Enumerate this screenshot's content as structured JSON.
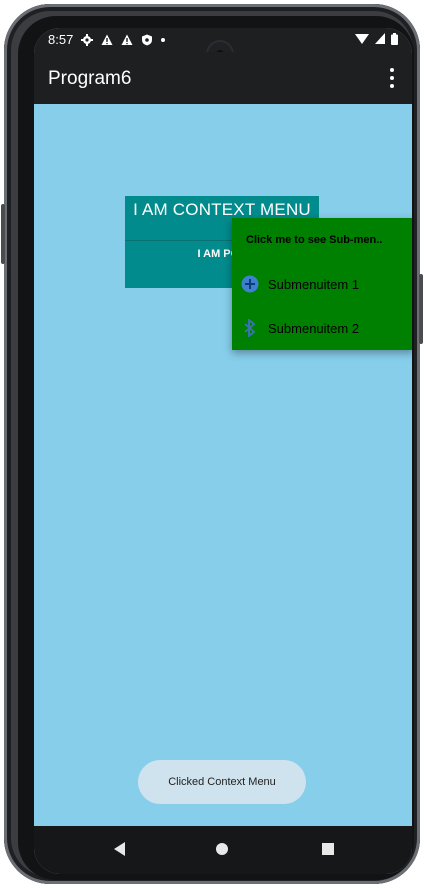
{
  "status_bar": {
    "time": "8:57",
    "left_icons": [
      "settings-gear-icon",
      "warning-icon",
      "warning-icon",
      "shield-icon",
      "dot-icon"
    ],
    "right_icons": [
      "wifi-icon",
      "signal-icon",
      "battery-icon"
    ]
  },
  "app_bar": {
    "title": "Program6",
    "overflow_icon": "more-vert-icon"
  },
  "main": {
    "context_menu_button_label": "I AM CONTEXT MENU",
    "popup_button_label": "I AM POP",
    "background_color": "#87ceeb",
    "button_color": "#028b8d"
  },
  "submenu": {
    "header": "Click me to see Sub-men..",
    "background_color": "#008000",
    "items": [
      {
        "label": "Submenuitem 1",
        "icon": "add-circle-icon"
      },
      {
        "label": "Submenuitem 2",
        "icon": "bluetooth-icon"
      }
    ]
  },
  "toast": {
    "text": "Clicked Context Menu"
  },
  "nav_bar": {
    "icons": [
      "back-icon",
      "home-icon",
      "recents-icon"
    ]
  }
}
